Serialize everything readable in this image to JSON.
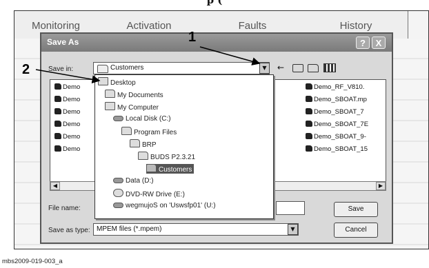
{
  "header_partial": "p (",
  "bg_tabs": [
    "Monitoring",
    "Activation",
    "Faults",
    "History"
  ],
  "dialog": {
    "title": "Save As",
    "help_btn": "?",
    "close_btn": "X",
    "save_in_label": "Save in:",
    "save_in_value": "Customers",
    "files_left": [
      "Demo",
      "Demo",
      "Demo",
      "Demo",
      "Demo",
      "Demo"
    ],
    "files_right": [
      "Demo_RF_V810.",
      "Demo_SBOAT.mp",
      "Demo_SBOAT_7",
      "Demo_SBOAT_7E",
      "Demo_SBOAT_9-",
      "Demo_SBOAT_15"
    ],
    "file_name_label": "File name:",
    "save_type_label": "Save as type:",
    "save_type_value": "MPEM files (*.mpem)",
    "save_button": "Save",
    "cancel_button": "Cancel"
  },
  "tree": [
    {
      "label": "Desktop",
      "icon": "desktop-icon"
    },
    {
      "label": "My Documents",
      "icon": "folder-icon"
    },
    {
      "label": "My Computer",
      "icon": "computer-icon"
    },
    {
      "label": "Local Disk (C:)",
      "icon": "drive-icon"
    },
    {
      "label": "Program Files",
      "icon": "folder-icon"
    },
    {
      "label": "BRP",
      "icon": "folder-icon"
    },
    {
      "label": "BUDS P2.3.21",
      "icon": "folder-icon"
    },
    {
      "label": "Customers",
      "icon": "folder-icon"
    },
    {
      "label": "Data (D:)",
      "icon": "drive-icon"
    },
    {
      "label": "DVD-RW Drive (E:)",
      "icon": "dvd-icon"
    },
    {
      "label": "wegmujoS on 'Uswsfp01' (U:)",
      "icon": "network-drive-icon"
    }
  ],
  "callouts": [
    "1",
    "2"
  ],
  "caption": "mbs2009-019-003_a"
}
